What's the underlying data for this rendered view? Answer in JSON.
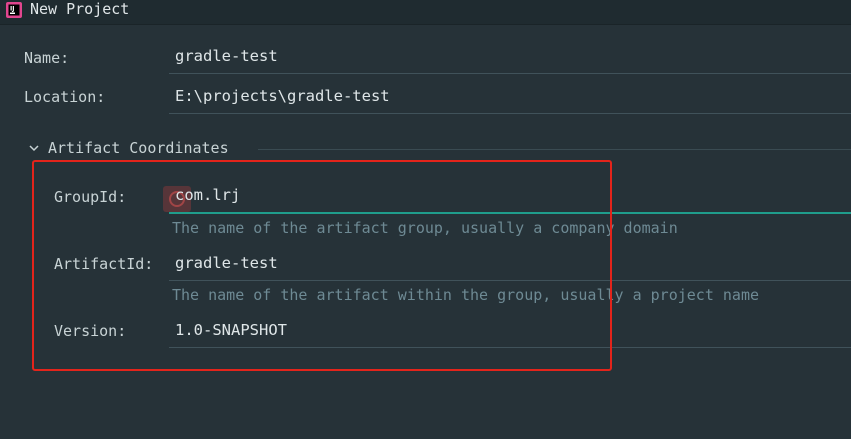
{
  "window": {
    "title": "New Project"
  },
  "form": {
    "name_label": "Name:",
    "name_value": "gradle-test",
    "location_label": "Location:",
    "location_value": "E:\\projects\\gradle-test"
  },
  "artifact": {
    "section_title": "Artifact Coordinates",
    "group_label": "GroupId:",
    "group_value": "com.lrj",
    "group_hint": "The name of the artifact group, usually a company domain",
    "artifact_label": "ArtifactId:",
    "artifact_value": "gradle-test",
    "artifact_hint": "The name of the artifact within the group, usually a project name",
    "version_label": "Version:",
    "version_value": "1.0-SNAPSHOT"
  },
  "colors": {
    "background": "#263238",
    "focus_underline": "#1f9d8c",
    "annotation_box": "#e3241b",
    "hint_text": "#6e8a94"
  },
  "icons": {
    "app": "intellij-app-icon",
    "section_toggle": "chevron-down-icon",
    "group_validation": "error-icon"
  }
}
